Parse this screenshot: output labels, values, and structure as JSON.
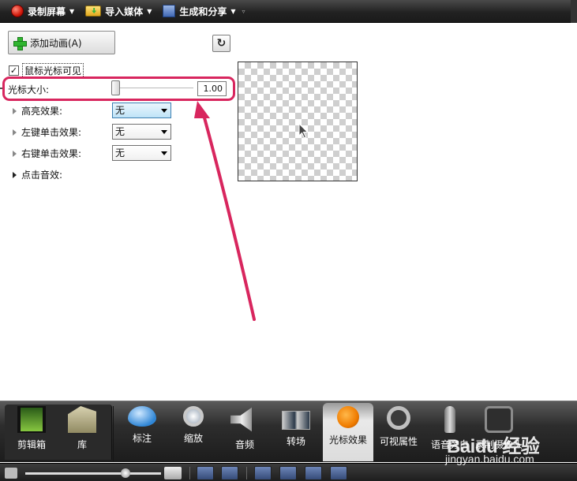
{
  "toolbar": {
    "record_label": "录制屏幕",
    "import_label": "导入媒体",
    "produce_label": "生成和分享"
  },
  "panel": {
    "add_animation_label": "添加动画(A)",
    "cursor_visible_label": "鼠标光标可见",
    "cursor_visible_checked": true,
    "cursor_size_label": "光标大小:",
    "cursor_size_value": "1.00",
    "effects": [
      {
        "label": "高亮效果:",
        "value": "无"
      },
      {
        "label": "左键单击效果:",
        "value": "无"
      },
      {
        "label": "右键单击效果:",
        "value": "无"
      }
    ],
    "click_sound_label": "点击音效:"
  },
  "dock": {
    "items": [
      {
        "label": "剪辑箱",
        "icon": "film-clip-icon"
      },
      {
        "label": "库",
        "icon": "library-icon"
      },
      {
        "label": "标注",
        "icon": "callout-icon"
      },
      {
        "label": "缩放",
        "icon": "zoom-icon"
      },
      {
        "label": "音频",
        "icon": "audio-icon"
      },
      {
        "label": "转场",
        "icon": "transition-icon"
      },
      {
        "label": "光标效果",
        "icon": "cursor-effects-icon",
        "active": true
      },
      {
        "label": "可视属性",
        "icon": "visual-properties-icon"
      },
      {
        "label": "语音旁白",
        "icon": "microphone-icon"
      },
      {
        "label": "录制摄像头",
        "icon": "camera-record-icon"
      }
    ]
  },
  "watermark": {
    "logo": "Baidu 经验",
    "url": "jingyan.baidu.com"
  },
  "colors": {
    "annotation": "#d8265e",
    "toolbar_bg": "#222222",
    "dock_bg": "#2d2d2d",
    "cursor_icon_orange": "#f07c00"
  }
}
